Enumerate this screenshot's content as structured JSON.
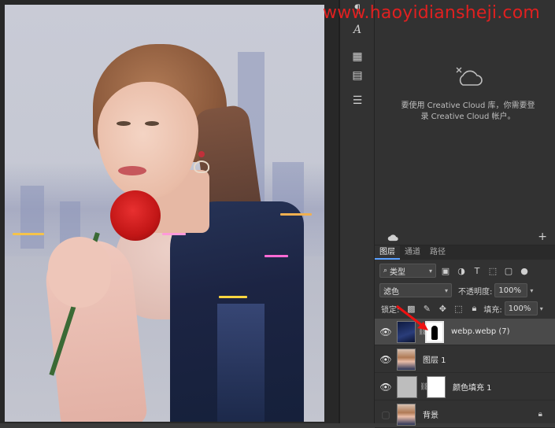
{
  "watermark": "www.haoyidiansheji.com",
  "canvas": {
    "description_label": "document canvas"
  },
  "cc_panel": {
    "message_line1": "要使用 Creative Cloud 库，你需要登",
    "message_line2": "录 Creative Cloud 帐户。",
    "add_label": "+"
  },
  "layers_panel": {
    "tabs": [
      {
        "label": "图层",
        "active": true
      },
      {
        "label": "通道",
        "active": false
      },
      {
        "label": "路径",
        "active": false
      }
    ],
    "filter_kind": "类型",
    "blend_mode": "滤色",
    "opacity_label": "不透明度:",
    "opacity_value": "100%",
    "lock_label": "锁定:",
    "fill_label": "填充:",
    "fill_value": "100%",
    "layers": [
      {
        "name": "webp.webp (7)",
        "visible": true,
        "selected": true,
        "has_mask": true
      },
      {
        "name": "图层 1",
        "visible": true,
        "selected": false,
        "has_mask": false
      },
      {
        "name": "颜色填充 1",
        "visible": true,
        "selected": false,
        "has_mask": true
      },
      {
        "name": "背景",
        "visible": false,
        "selected": false,
        "locked": true
      }
    ]
  },
  "colors": {
    "panel_bg": "#323232",
    "canvas_bg": "#282828",
    "watermark": "#e02020",
    "accent": "#5aa0ff"
  }
}
